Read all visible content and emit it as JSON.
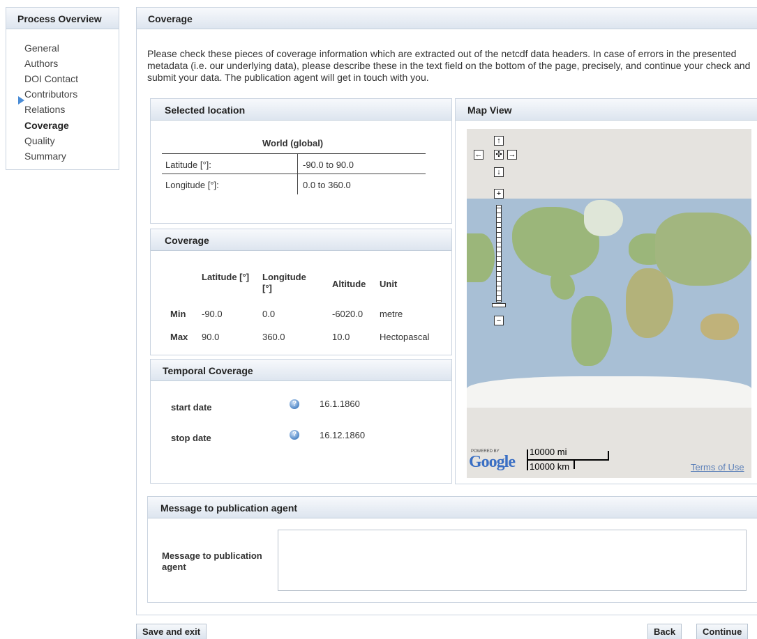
{
  "sidebar": {
    "title": "Process Overview",
    "items": [
      {
        "label": "General"
      },
      {
        "label": "Authors"
      },
      {
        "label": "DOI Contact"
      },
      {
        "label": "Contributors"
      },
      {
        "label": "Relations"
      },
      {
        "label": "Coverage",
        "active": true
      },
      {
        "label": "Quality"
      },
      {
        "label": "Summary"
      }
    ]
  },
  "main": {
    "title": "Coverage",
    "intro": "Please check these pieces of coverage information which are extracted out of the netcdf data headers. In case of errors in the presented metadata (i.e. our underlying data), please describe these in the text field on the bottom of the page, precisely, and continue your check and submit your data. The publication agent will get in touch with you."
  },
  "selected_location": {
    "title": "Selected location",
    "region": "World (global)",
    "rows": [
      {
        "label": "Latitude [°]:",
        "value": "-90.0 to 90.0"
      },
      {
        "label": "Longitude [°]:",
        "value": "0.0 to 360.0"
      }
    ]
  },
  "coverage": {
    "title": "Coverage",
    "headers": [
      "Latitude [°]",
      "Longitude [°]",
      "Altitude",
      "Unit"
    ],
    "rows": [
      {
        "label": "Min",
        "lat": "-90.0",
        "lon": "0.0",
        "alt": "-6020.0",
        "unit": "metre"
      },
      {
        "label": "Max",
        "lat": "90.0",
        "lon": "360.0",
        "alt": "10.0",
        "unit": "Hectopascal"
      }
    ]
  },
  "temporal": {
    "title": "Temporal Coverage",
    "start_label": "start date",
    "start_value": "16.1.1860",
    "stop_label": "stop date",
    "stop_value": "16.12.1860",
    "help_icon": "help-icon"
  },
  "map": {
    "title": "Map View",
    "powered_by": "POWERED BY",
    "logo": "Google",
    "scale_mi": "10000 mi",
    "scale_km": "10000 km",
    "terms": "Terms of Use",
    "colors": {
      "ocean": "#a8bfd5",
      "land": "#9bb67a",
      "ice": "#f4f4f2",
      "bg": "#e5e3df"
    }
  },
  "message": {
    "title": "Message to publication agent",
    "label": "Message to publication agent",
    "value": ""
  },
  "buttons": {
    "save_exit": "Save and exit",
    "back": "Back",
    "continue": "Continue"
  }
}
